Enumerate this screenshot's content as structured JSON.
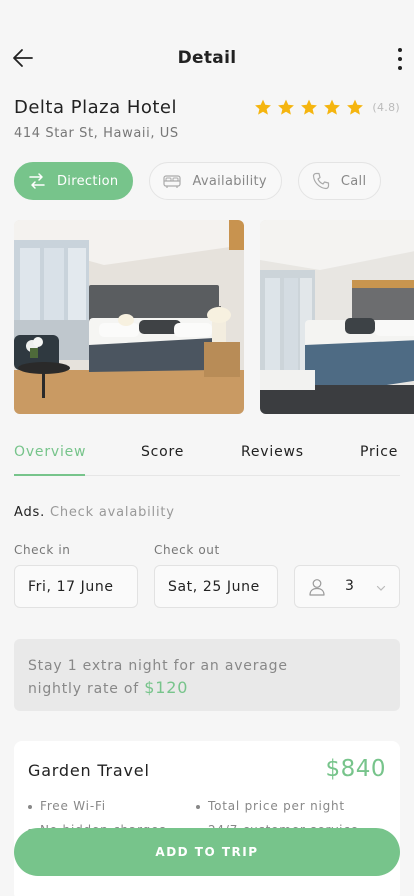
{
  "header": {
    "title": "Detail"
  },
  "hotel": {
    "name": "Delta Plaza Hotel",
    "address": "414 Star St, Hawaii, US",
    "rating_text": "(4.8)",
    "stars": 5
  },
  "actions": {
    "direction": "Direction",
    "availability": "Availability",
    "call": "Call"
  },
  "tabs": [
    "Overview",
    "Score",
    "Reviews",
    "Price"
  ],
  "ads": {
    "label": "Ads.",
    "link": "Check avalability"
  },
  "booking": {
    "check_in_label": "Check in",
    "check_in_value": "Fri, 17 June",
    "check_out_label": "Check out",
    "check_out_value": "Sat, 25 June",
    "guests": "3"
  },
  "promo": {
    "text_line1": "Stay 1 extra night for an average",
    "text_line2": "nightly rate of",
    "price": "$120"
  },
  "offer": {
    "title": "Garden Travel",
    "price": "$840",
    "features": [
      "Free Wi-Fi",
      "Total price per night",
      "No hidden charges",
      "24/7 customer service"
    ]
  },
  "cta": {
    "add_label": "ADD TO TRIP"
  },
  "colors": {
    "accent": "#77c48b",
    "star": "#f5b50f"
  }
}
